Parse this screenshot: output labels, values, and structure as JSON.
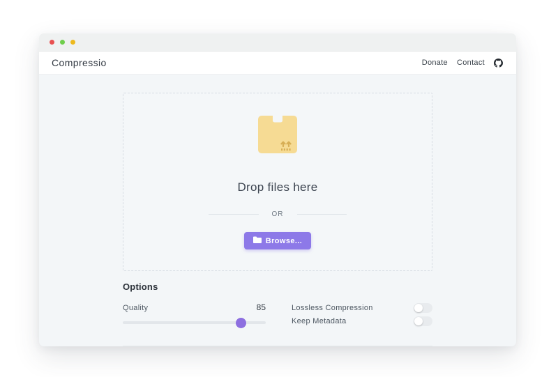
{
  "window": {
    "traffic_lights": [
      {
        "name": "close",
        "color": "#e85050"
      },
      {
        "name": "minimize",
        "color": "#6fce4c"
      },
      {
        "name": "maximize",
        "color": "#edb91e"
      }
    ]
  },
  "header": {
    "brand": "Compressio",
    "links": [
      {
        "label": "Donate"
      },
      {
        "label": "Contact"
      }
    ],
    "icons": [
      "github-icon"
    ]
  },
  "dropzone": {
    "icon": "package-icon",
    "title": "Drop files here",
    "divider_label": "OR",
    "browse_button": {
      "label": "Browse...",
      "icon": "folder-icon"
    }
  },
  "options": {
    "heading": "Options",
    "quality": {
      "label": "Quality",
      "value": "85"
    },
    "toggles": [
      {
        "label": "Lossless Compression",
        "enabled": false
      },
      {
        "label": "Keep Metadata",
        "enabled": false
      }
    ]
  },
  "colors": {
    "accent": "#8d79e8",
    "slider_thumb": "#8d6fe0",
    "package_icon_fill": "#f6db94",
    "package_icon_detail": "#d7ae55",
    "content_background": "#f3f6f8"
  }
}
